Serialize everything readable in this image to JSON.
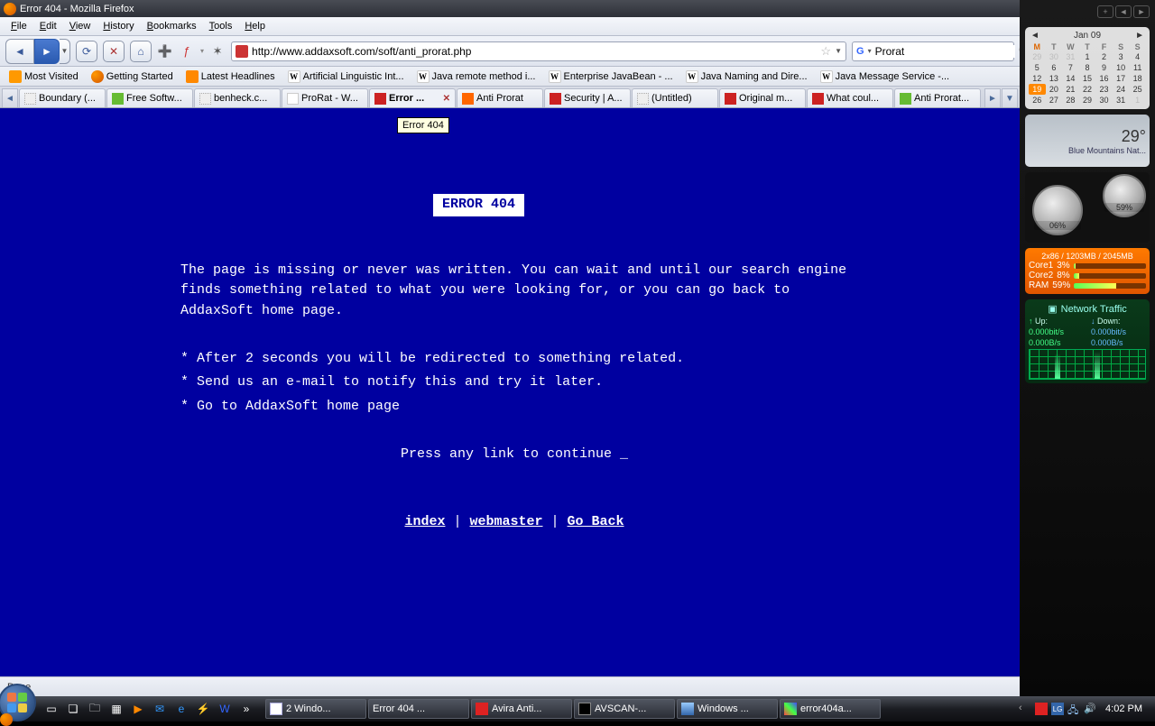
{
  "window": {
    "title": "Error 404 - Mozilla Firefox"
  },
  "menubar": [
    "File",
    "Edit",
    "View",
    "History",
    "Bookmarks",
    "Tools",
    "Help"
  ],
  "toolbar": {
    "url": "http://www.addaxsoft.com/soft/anti_prorat.php",
    "search_engine": "G",
    "search_value": "Prorat"
  },
  "bookmarks": [
    {
      "icon": "orange",
      "label": "Most Visited"
    },
    {
      "icon": "fox",
      "label": "Getting Started"
    },
    {
      "icon": "rss",
      "label": "Latest Headlines"
    },
    {
      "icon": "wiki",
      "label": "Artificial Linguistic Int..."
    },
    {
      "icon": "wiki",
      "label": "Java remote method i..."
    },
    {
      "icon": "wiki",
      "label": "Enterprise JavaBean - ..."
    },
    {
      "icon": "wiki",
      "label": "Java Naming and Dire..."
    },
    {
      "icon": "wiki",
      "label": "Java Message Service -..."
    }
  ],
  "tabs": [
    {
      "icon": "blank",
      "label": "Boundary (..."
    },
    {
      "icon": "green",
      "label": "Free Softw..."
    },
    {
      "icon": "blank",
      "label": "benheck.c..."
    },
    {
      "icon": "wikif",
      "label": "ProRat - W..."
    },
    {
      "icon": "red",
      "label": "Error ...",
      "active": true,
      "close": true
    },
    {
      "icon": "blogger",
      "label": "Anti Prorat"
    },
    {
      "icon": "red",
      "label": "Security | A..."
    },
    {
      "icon": "blank",
      "label": "(Untitled)"
    },
    {
      "icon": "red",
      "label": "Original m..."
    },
    {
      "icon": "red",
      "label": "What coul..."
    },
    {
      "icon": "green",
      "label": "Anti Prorat..."
    }
  ],
  "page": {
    "tooltip": "Error 404",
    "heading": "ERROR 404",
    "para": "The page is missing or never was written. You can wait and until our search engine finds something related to what you were looking for, or you can go back to AddaxSoft home page.",
    "bullet1": "* After 2 seconds you will be redirected to something related.",
    "bullet2": "* Send us an e-mail to notify this and try it later.",
    "bullet3": "* Go to AddaxSoft home page",
    "press": "Press any link to continue _",
    "link_index": "index",
    "sep": " | ",
    "link_webmaster": "webmaster",
    "link_goback": "Go Back"
  },
  "statusbar": {
    "text": "Done"
  },
  "sidebar": {
    "calendar": {
      "month": "Jan 09",
      "dow": [
        "M",
        "T",
        "W",
        "T",
        "F",
        "S",
        "S"
      ],
      "rows": [
        [
          "29",
          "30",
          "31",
          "1",
          "2",
          "3",
          "4"
        ],
        [
          "5",
          "6",
          "7",
          "8",
          "9",
          "10",
          "11"
        ],
        [
          "12",
          "13",
          "14",
          "15",
          "16",
          "17",
          "18"
        ],
        [
          "19",
          "20",
          "21",
          "22",
          "23",
          "24",
          "25"
        ],
        [
          "26",
          "27",
          "28",
          "29",
          "30",
          "31",
          "1"
        ]
      ],
      "today": "19"
    },
    "weather": {
      "temp": "29°",
      "loc": "Blue Mountains Nat..."
    },
    "gauge": {
      "cpu": "06%",
      "ram": "59%"
    },
    "cpu": {
      "hdr": "2x86 / 1203MB / 2045MB",
      "core1_lbl": "Core1",
      "core1_val": "3%",
      "core1_w": "3%",
      "core2_lbl": "Core2",
      "core2_val": "8%",
      "core2_w": "8%",
      "ram_lbl": "RAM",
      "ram_val": "59%",
      "ram_w": "59%"
    },
    "net": {
      "title": "Network Traffic",
      "up_lbl": "Up:",
      "dn_lbl": "Down:",
      "up_bits": "0.000bit/s",
      "dn_bits": "0.000bit/s",
      "up_bytes": "0.000B/s",
      "dn_bytes": "0.000B/s"
    }
  },
  "taskbar": {
    "items": [
      {
        "icon": "notepad",
        "label": "2 Windo..."
      },
      {
        "icon": "ff",
        "label": "Error 404 ..."
      },
      {
        "icon": "avira",
        "label": "Avira Anti..."
      },
      {
        "icon": "cmd",
        "label": "AVSCAN-..."
      },
      {
        "icon": "aero",
        "label": "Windows ..."
      },
      {
        "icon": "paint",
        "label": "error404a..."
      }
    ],
    "clock": "4:02 PM"
  }
}
